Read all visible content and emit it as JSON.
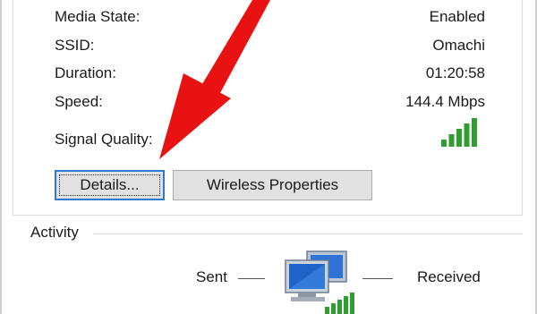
{
  "status": {
    "media_state_label": "Media State:",
    "media_state_value": "Enabled",
    "ssid_label": "SSID:",
    "ssid_value": "Omachi",
    "duration_label": "Duration:",
    "duration_value": "01:20:58",
    "speed_label": "Speed:",
    "speed_value": "144.4 Mbps",
    "signal_quality_label": "Signal Quality:",
    "signal_bars_filled": 5,
    "signal_bars_total": 5
  },
  "buttons": {
    "details_label": "Details...",
    "wireless_properties_label": "Wireless Properties"
  },
  "activity": {
    "section_label": "Activity",
    "sent_label": "Sent",
    "received_label": "Received"
  },
  "colors": {
    "signal_green": "#2e9e2e",
    "arrow_red": "#e81212",
    "focus_blue": "#2d7ad6"
  },
  "icons": {
    "signal": "signal-strength-icon",
    "network": "network-computers-icon",
    "annotation": "red-arrow-annotation"
  }
}
